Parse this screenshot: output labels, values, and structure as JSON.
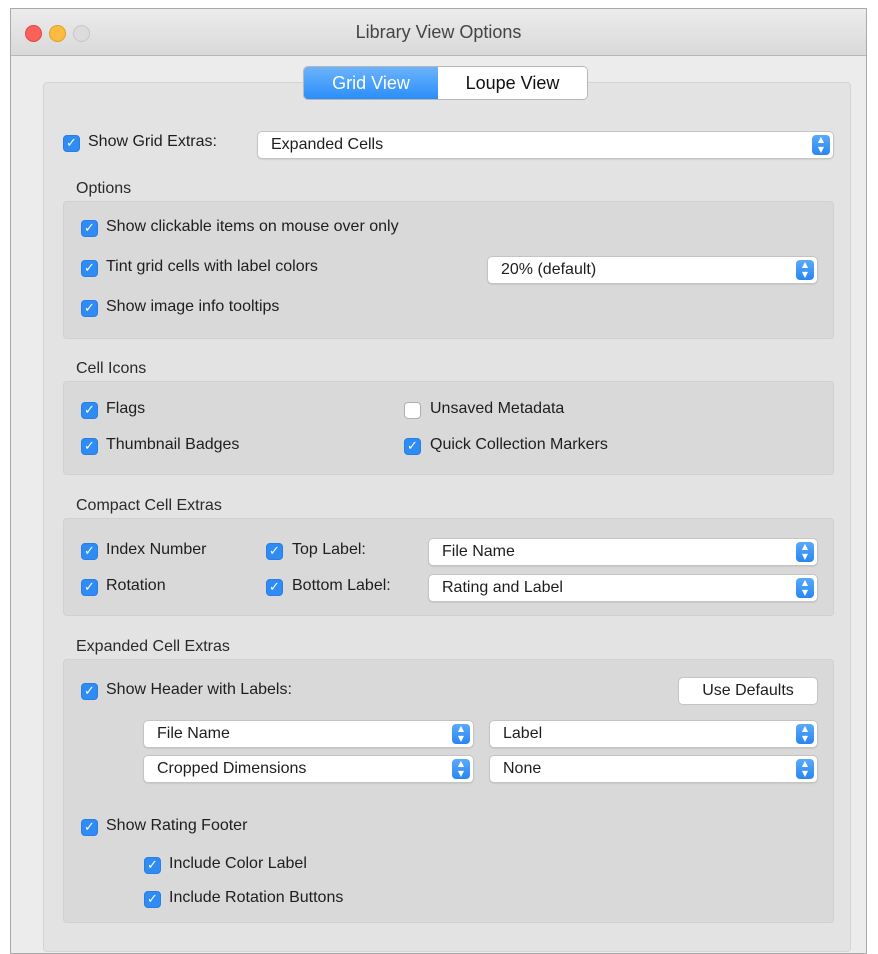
{
  "window": {
    "title": "Library View Options"
  },
  "tabs": [
    {
      "label": "Grid View",
      "selected": true
    },
    {
      "label": "Loupe View",
      "selected": false
    }
  ],
  "show_grid_extras": {
    "label": "Show Grid Extras:",
    "checked": true,
    "value": "Expanded Cells"
  },
  "options": {
    "title": "Options",
    "show_clickable": {
      "label": "Show clickable items on mouse over only",
      "checked": true
    },
    "tint_cells": {
      "label": "Tint grid cells with label colors",
      "checked": true,
      "value": "20% (default)"
    },
    "image_info": {
      "label": "Show image info tooltips",
      "checked": true
    }
  },
  "cell_icons": {
    "title": "Cell Icons",
    "flags": {
      "label": "Flags",
      "checked": true
    },
    "unsaved_metadata": {
      "label": "Unsaved Metadata",
      "checked": false
    },
    "thumbnail_badges": {
      "label": "Thumbnail Badges",
      "checked": true
    },
    "quick_collection": {
      "label": "Quick Collection Markers",
      "checked": true
    }
  },
  "compact": {
    "title": "Compact Cell Extras",
    "index_number": {
      "label": "Index Number",
      "checked": true
    },
    "rotation": {
      "label": "Rotation",
      "checked": true
    },
    "top_label": {
      "label": "Top Label:",
      "checked": true,
      "value": "File Name"
    },
    "bottom_label": {
      "label": "Bottom Label:",
      "checked": true,
      "value": "Rating and Label"
    }
  },
  "expanded": {
    "title": "Expanded Cell Extras",
    "show_header": {
      "label": "Show Header with Labels:",
      "checked": true
    },
    "use_defaults": "Use Defaults",
    "header_popups": [
      "File Name",
      "Label",
      "Cropped Dimensions",
      "None"
    ],
    "rating_footer": {
      "label": "Show Rating Footer",
      "checked": true
    },
    "include_color": {
      "label": "Include Color Label",
      "checked": true
    },
    "include_rotation": {
      "label": "Include Rotation Buttons",
      "checked": true
    }
  },
  "icons": {
    "checkmark": "checkmark-icon",
    "stepper": "up-down-chevron-icon"
  },
  "colors": {
    "accent": "#2f8cf5",
    "close": "#fc605b",
    "minimize": "#fdbc40",
    "zoom": "#dcdcdc"
  }
}
